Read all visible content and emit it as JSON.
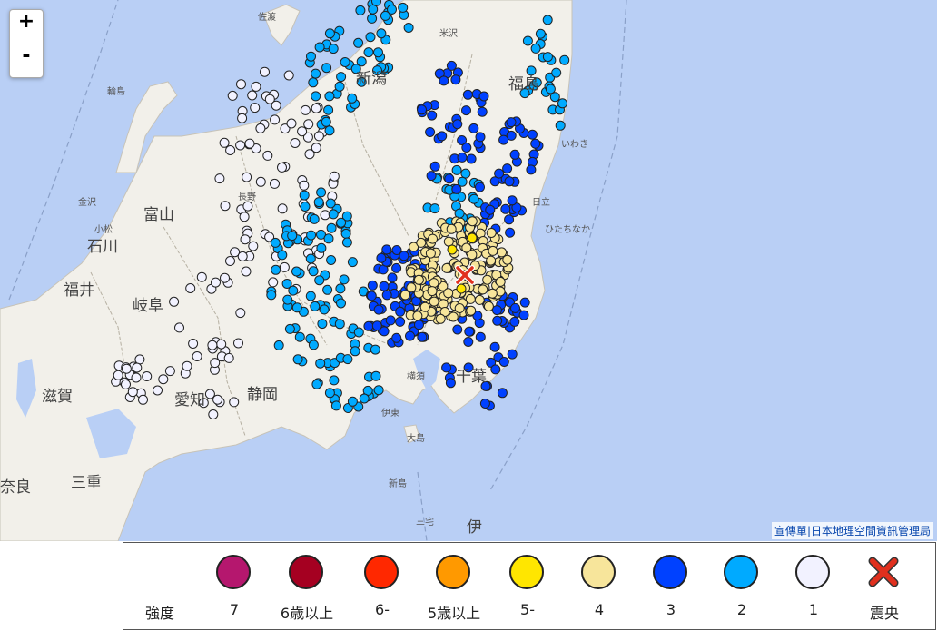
{
  "map": {
    "zoom_in": "+",
    "zoom_out": "-",
    "attribution": {
      "link1": "宣傳單",
      "separator": "|",
      "link2": "日本地理空間資訊管理局"
    },
    "labels": {
      "sado": "佐渡",
      "niigata": "新潟",
      "toyama": "富山",
      "ishikawa": "石川",
      "fukui": "福井",
      "gifu": "岐阜",
      "aichi": "愛知",
      "shizuoka": "静岡",
      "shiga": "滋賀",
      "mie": "三重",
      "nara": "奈良",
      "chiba": "千葉",
      "yokosuka": "横須",
      "fukushima": "福島",
      "wajima": "輪島",
      "kanazawa": "金沢",
      "nagano": "長野",
      "iwaki": "いわき",
      "hitachi": "日立",
      "hitachinaka": "ひたちなか",
      "ito": "伊東",
      "oshima": "大島",
      "niijima": "新島",
      "miyake": "三宅",
      "izu": "伊",
      "komatsu": "小松",
      "yonezawa": "米沢"
    }
  },
  "legend": {
    "title": "強度",
    "items": [
      {
        "label": "7",
        "color": "#b5176e"
      },
      {
        "label": "6歳以上",
        "color": "#a50021"
      },
      {
        "label": "6-",
        "color": "#ff2800"
      },
      {
        "label": "5歳以上",
        "color": "#ff9900"
      },
      {
        "label": "5-",
        "color": "#ffe600"
      },
      {
        "label": "4",
        "color": "#f7e59b"
      },
      {
        "label": "3",
        "color": "#0041ff"
      },
      {
        "label": "2",
        "color": "#00aaff"
      },
      {
        "label": "1",
        "color": "#f2f2ff"
      },
      {
        "label": "震央",
        "color": "#e0301e",
        "icon": "epicenter-x-icon"
      }
    ]
  }
}
